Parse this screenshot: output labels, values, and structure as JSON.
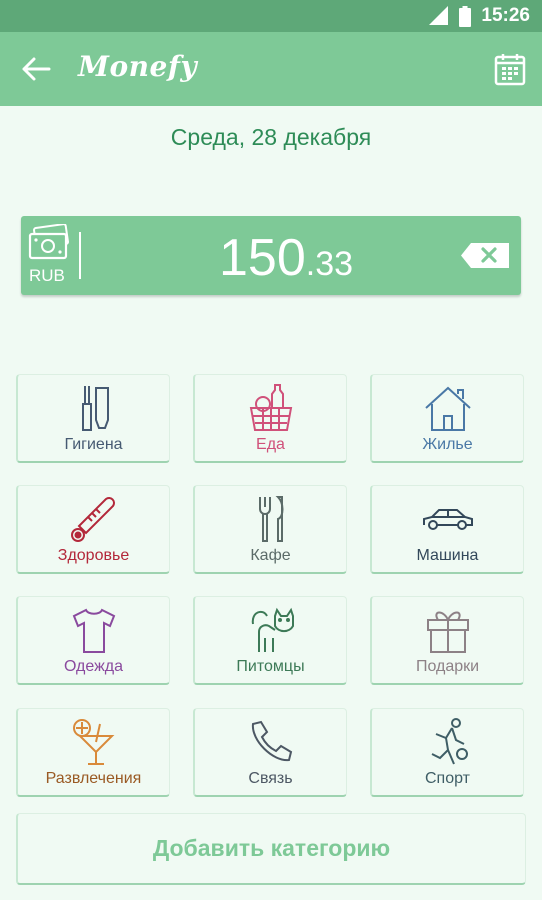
{
  "status_bar": {
    "time": "15:26"
  },
  "app_bar": {
    "logo": "Monefy"
  },
  "date": "Среда, 28 декабря",
  "amount": {
    "currency": "RUB",
    "integer": "150",
    "decimal": ".33"
  },
  "categories": [
    {
      "label": "Гигиена",
      "color": "#465a72",
      "icon": "toothbrush-icon"
    },
    {
      "label": "Еда",
      "color": "#d0517a",
      "icon": "food-basket-icon"
    },
    {
      "label": "Жилье",
      "color": "#4a78a6",
      "icon": "house-icon"
    },
    {
      "label": "Здоровье",
      "color": "#b3283a",
      "icon": "thermometer-icon"
    },
    {
      "label": "Кафе",
      "color": "#5b6b68",
      "icon": "fork-knife-icon"
    },
    {
      "label": "Машина",
      "color": "#33485a",
      "icon": "car-icon"
    },
    {
      "label": "Одежда",
      "color": "#8a4a9e",
      "icon": "tshirt-icon"
    },
    {
      "label": "Питомцы",
      "color": "#3d7a57",
      "icon": "cat-icon"
    },
    {
      "label": "Подарки",
      "color": "#8d8186",
      "icon": "gift-icon"
    },
    {
      "label": "Развлечения",
      "color": "#9a5a24",
      "icon": "cocktail-icon"
    },
    {
      "label": "Связь",
      "color": "#4d5864",
      "icon": "phone-icon"
    },
    {
      "label": "Спорт",
      "color": "#3f5e66",
      "icon": "soccer-player-icon"
    }
  ],
  "add_category": "Добавить категорию",
  "colors": {
    "accent": "#7ec997",
    "dark_accent": "#5ea878",
    "background": "#f0faf3",
    "date_text": "#2e8c57"
  }
}
